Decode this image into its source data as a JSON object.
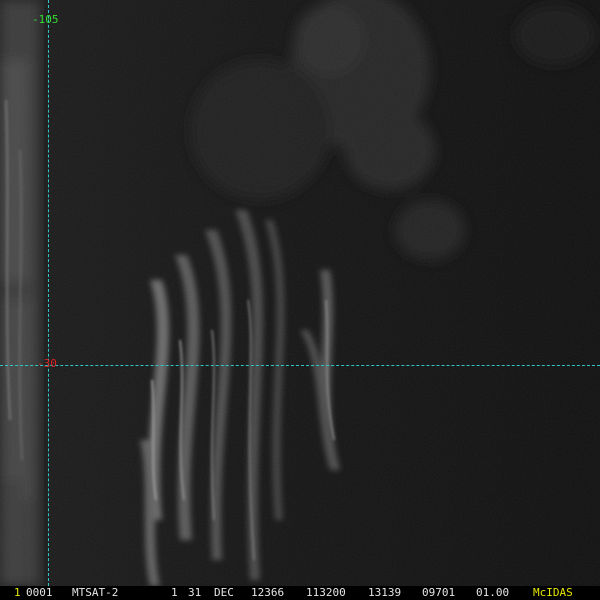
{
  "grid": {
    "longitude_label": "-105",
    "latitude_label": "-30",
    "line_color": "#2ec6c6",
    "longitude_label_color": "#33dd33",
    "latitude_label_color": "#dd2222"
  },
  "status_bar": {
    "frame_number": "1",
    "frame_index": "0001",
    "satellite": "MTSAT-2",
    "band": "1",
    "day": "31",
    "month": "DEC",
    "julian_date": "12366",
    "time": "113200",
    "line_start": "13139",
    "element_start": "09701",
    "resolution": "01.00",
    "software": "McIDAS",
    "frame_number_color": "#e6e600",
    "software_color": "#e6e600",
    "text_color": "#e6e6e6"
  }
}
